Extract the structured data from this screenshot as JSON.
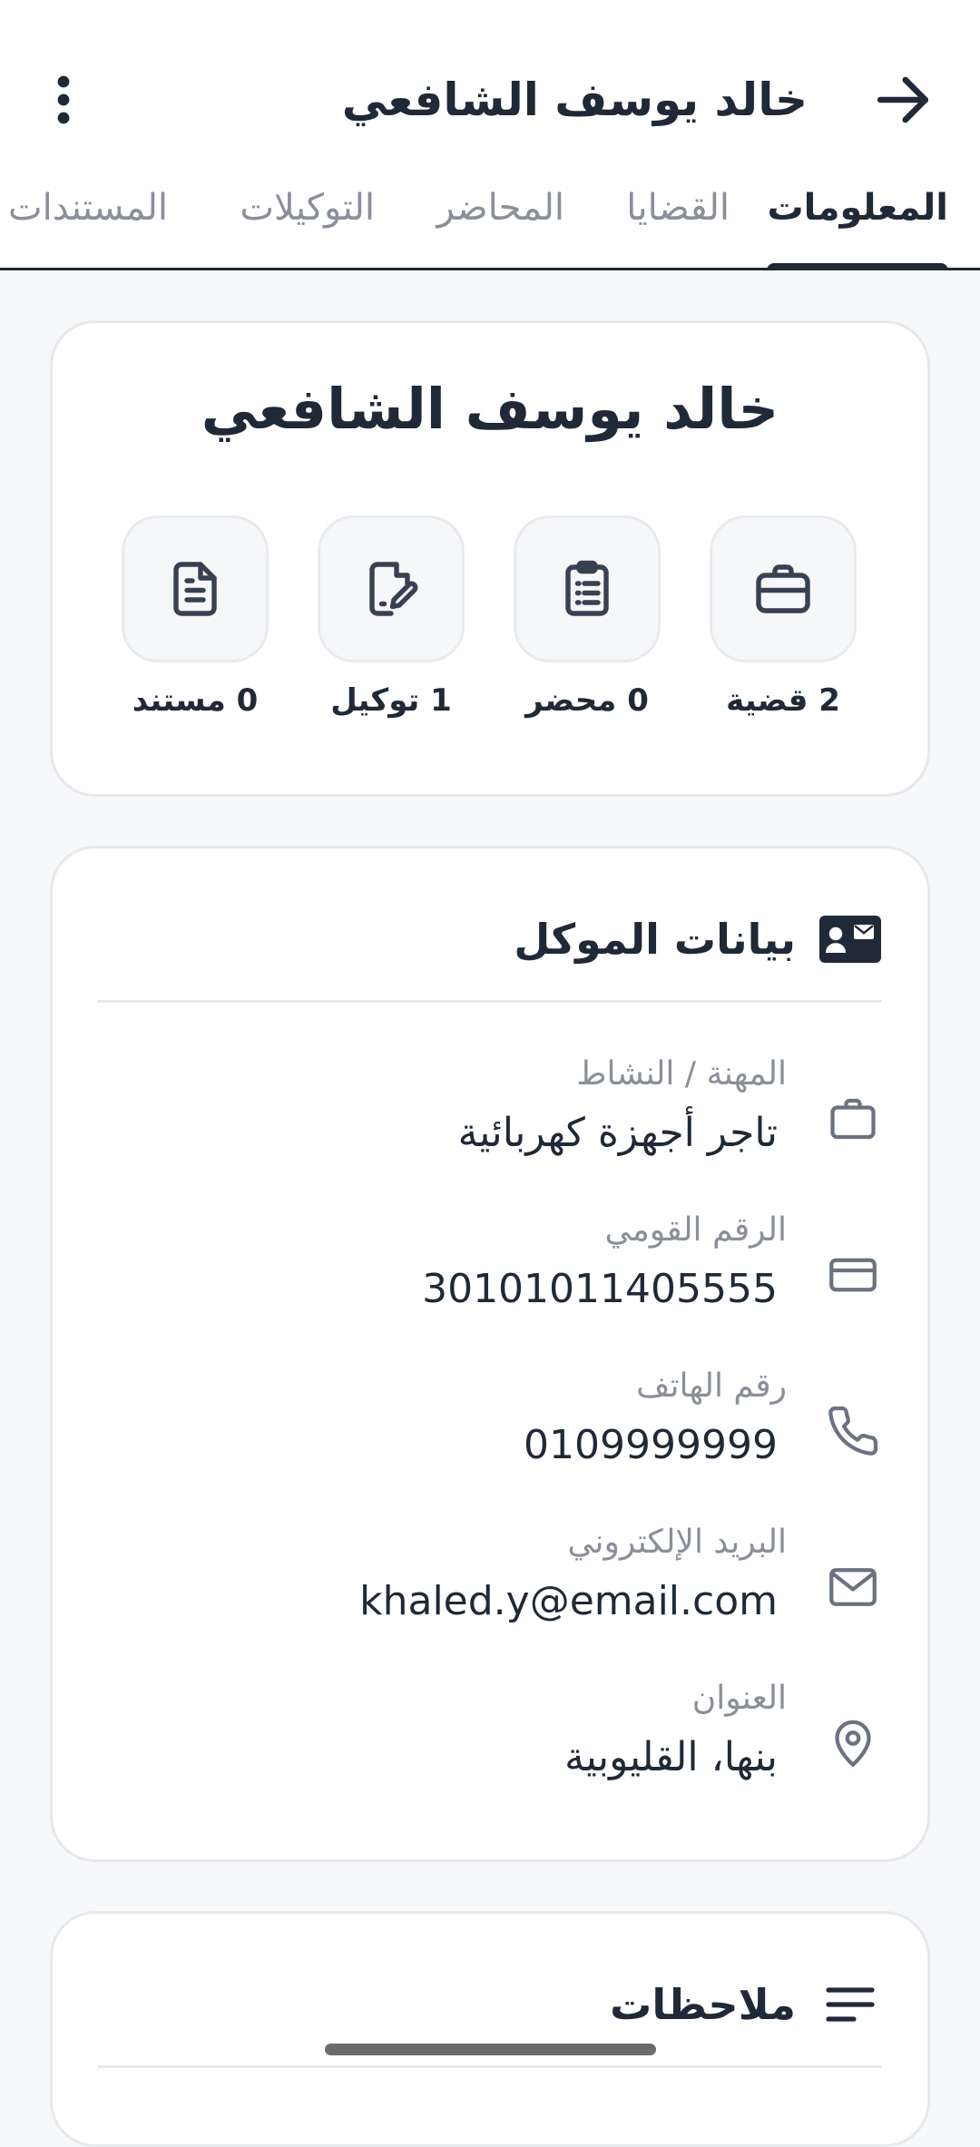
{
  "header": {
    "title": "خالد يوسف الشافعي",
    "back_icon": "arrow-right-icon",
    "menu_icon": "more-vertical-icon"
  },
  "tabs": [
    {
      "label": "المعلومات",
      "active": true
    },
    {
      "label": "القضايا",
      "active": false
    },
    {
      "label": "المحاضر",
      "active": false
    },
    {
      "label": "التوكيلات",
      "active": false
    },
    {
      "label": "المستندات",
      "active": false
    }
  ],
  "profile": {
    "name": "خالد يوسف الشافعي",
    "stats": [
      {
        "icon": "briefcase-icon",
        "label": "2 قضية"
      },
      {
        "icon": "clipboard-list-icon",
        "label": "0 محضر"
      },
      {
        "icon": "file-signature-icon",
        "label": "1 توكيل"
      },
      {
        "icon": "document-icon",
        "label": "0 مستند"
      }
    ]
  },
  "client_info": {
    "title": "بيانات الموكل",
    "icon": "id-card-icon",
    "rows": [
      {
        "icon": "briefcase-icon",
        "label": "المهنة / النشاط",
        "value": "تاجر أجهزة كهربائية"
      },
      {
        "icon": "credit-card-icon",
        "label": "الرقم القومي",
        "value": "30101011405555"
      },
      {
        "icon": "phone-icon",
        "label": "رقم الهاتف",
        "value": "0109999999"
      },
      {
        "icon": "mail-icon",
        "label": "البريد الإلكتروني",
        "value": "khaled.y@email.com"
      },
      {
        "icon": "location-pin-icon",
        "label": "العنوان",
        "value": "بنها، القليوبية"
      }
    ]
  },
  "notes": {
    "title": "ملاحظات",
    "icon": "lines-icon"
  },
  "colors": {
    "primary": "#1f2937",
    "muted": "#8a8f98",
    "background": "#f7f8fa",
    "card_border": "#e6e8ec"
  }
}
